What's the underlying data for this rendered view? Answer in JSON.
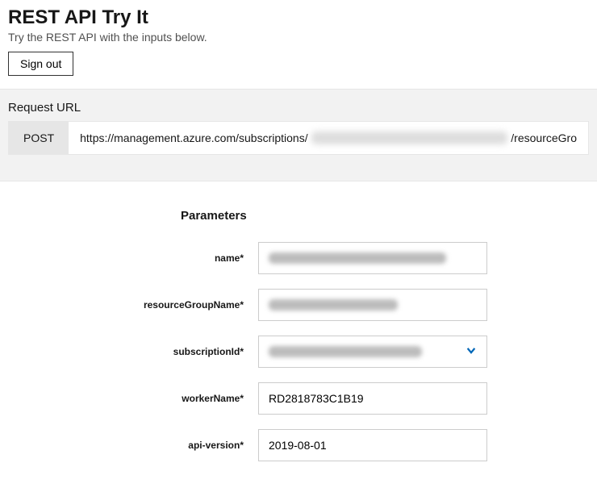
{
  "header": {
    "title": "REST API Try It",
    "subtitle": "Try the REST API with the inputs below.",
    "signout_label": "Sign out"
  },
  "request": {
    "label": "Request URL",
    "method": "POST",
    "url_prefix": "https://management.azure.com/subscriptions/",
    "url_suffix": "/resourceGro"
  },
  "parameters": {
    "heading": "Parameters",
    "rows": [
      {
        "label": "name*",
        "value": "",
        "redacted": true,
        "type": "text",
        "blur_width": 220
      },
      {
        "label": "resourceGroupName*",
        "value": "",
        "redacted": true,
        "type": "text",
        "blur_width": 160
      },
      {
        "label": "subscriptionId*",
        "value": "",
        "redacted": true,
        "type": "select",
        "blur_width": 190
      },
      {
        "label": "workerName*",
        "value": "RD2818783C1B19",
        "redacted": false,
        "type": "text"
      },
      {
        "label": "api-version*",
        "value": "2019-08-01",
        "redacted": false,
        "type": "text"
      }
    ]
  }
}
